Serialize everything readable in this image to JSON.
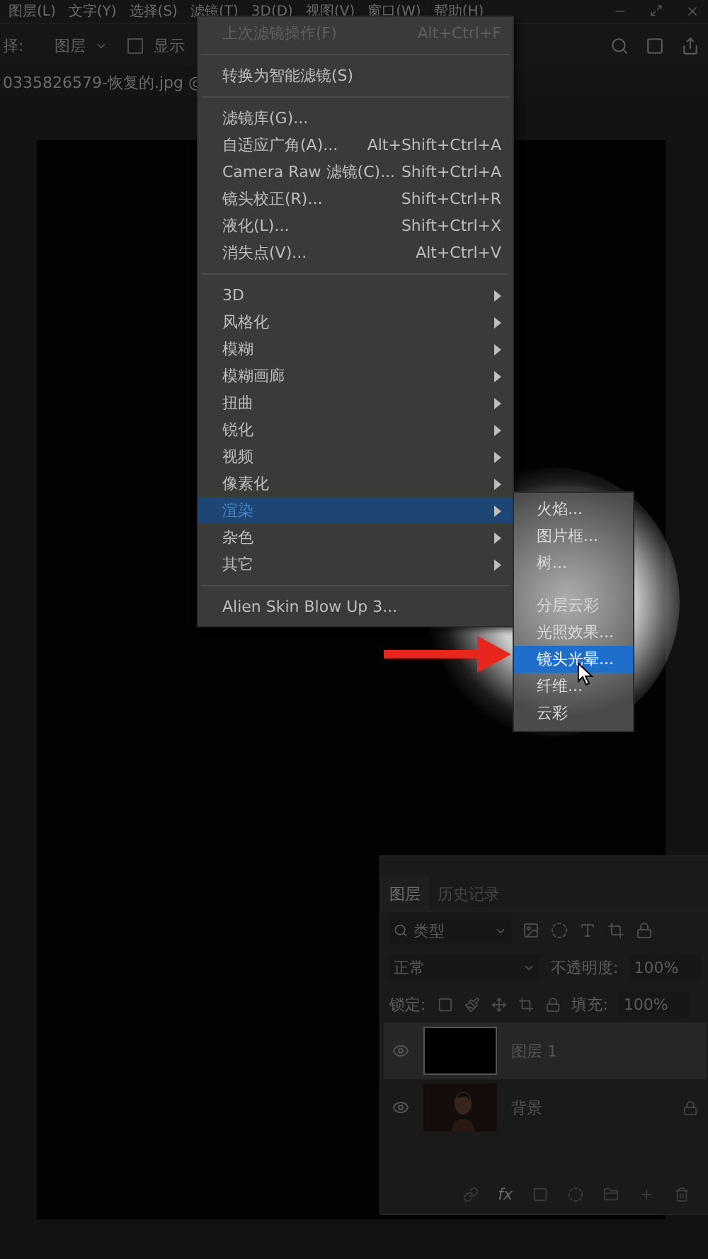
{
  "menubar": [
    {
      "label": "图层(L)"
    },
    {
      "label": "文字(Y)"
    },
    {
      "label": "选择(S)"
    },
    {
      "label": "滤镜(T)"
    },
    {
      "label": "3D(D)"
    },
    {
      "label": "视图(V)"
    },
    {
      "label": "窗口(W)"
    },
    {
      "label": "帮助(H)"
    }
  ],
  "options_bar": {
    "label": "择:",
    "layer_select": "图层",
    "show_checkbox": {
      "label": "显示",
      "checked": false
    }
  },
  "document_tab": "0335826579-恢复的.jpg @",
  "filter_menu": [
    {
      "kind": "item",
      "label": "上次滤镜操作(F)",
      "shortcut": "Alt+Ctrl+F",
      "disabled": true,
      "selected": false
    },
    {
      "kind": "separator"
    },
    {
      "kind": "item",
      "label": "转换为智能滤镜(S)",
      "disabled": false,
      "selected": false
    },
    {
      "kind": "separator"
    },
    {
      "kind": "item",
      "label": "滤镜库(G)...",
      "disabled": false,
      "selected": false
    },
    {
      "kind": "item",
      "label": "自适应广角(A)...",
      "shortcut": "Alt+Shift+Ctrl+A",
      "disabled": false,
      "selected": false
    },
    {
      "kind": "item",
      "label": "Camera Raw 滤镜(C)...",
      "shortcut": "Shift+Ctrl+A",
      "disabled": false,
      "selected": false
    },
    {
      "kind": "item",
      "label": "镜头校正(R)...",
      "shortcut": "Shift+Ctrl+R",
      "disabled": false,
      "selected": false
    },
    {
      "kind": "item",
      "label": "液化(L)...",
      "shortcut": "Shift+Ctrl+X",
      "disabled": false,
      "selected": false
    },
    {
      "kind": "item",
      "label": "消失点(V)...",
      "shortcut": "Alt+Ctrl+V",
      "disabled": false,
      "selected": false
    },
    {
      "kind": "separator"
    },
    {
      "kind": "submenu",
      "label": "3D",
      "disabled": false,
      "selected": false
    },
    {
      "kind": "submenu",
      "label": "风格化",
      "disabled": false,
      "selected": false
    },
    {
      "kind": "submenu",
      "label": "模糊",
      "disabled": false,
      "selected": false
    },
    {
      "kind": "submenu",
      "label": "模糊画廊",
      "disabled": false,
      "selected": false
    },
    {
      "kind": "submenu",
      "label": "扭曲",
      "disabled": false,
      "selected": false
    },
    {
      "kind": "submenu",
      "label": "锐化",
      "disabled": false,
      "selected": false
    },
    {
      "kind": "submenu",
      "label": "视频",
      "disabled": false,
      "selected": false
    },
    {
      "kind": "submenu",
      "label": "像素化",
      "disabled": false,
      "selected": false
    },
    {
      "kind": "submenu",
      "label": "渲染",
      "disabled": false,
      "selected": true
    },
    {
      "kind": "submenu",
      "label": "杂色",
      "disabled": false,
      "selected": false
    },
    {
      "kind": "submenu",
      "label": "其它",
      "disabled": false,
      "selected": false
    },
    {
      "kind": "separator"
    },
    {
      "kind": "item",
      "label": "Alien Skin Blow Up 3...",
      "disabled": false,
      "selected": false
    }
  ],
  "render_submenu": [
    {
      "kind": "item",
      "label": "火焰...",
      "selected": false
    },
    {
      "kind": "item",
      "label": "图片框...",
      "selected": false
    },
    {
      "kind": "item",
      "label": "树...",
      "selected": false
    },
    {
      "kind": "separator"
    },
    {
      "kind": "item",
      "label": "分层云彩",
      "selected": false
    },
    {
      "kind": "item",
      "label": "光照效果...",
      "selected": false
    },
    {
      "kind": "item",
      "label": "镜头光晕...",
      "selected": true
    },
    {
      "kind": "item",
      "label": "纤维...",
      "selected": false
    },
    {
      "kind": "item",
      "label": "云彩",
      "selected": false
    }
  ],
  "layers_panel": {
    "tabs": [
      {
        "label": "图层",
        "selected": true
      },
      {
        "label": "历史记录",
        "selected": false
      }
    ],
    "filter": "类型",
    "blend_mode": "正常",
    "opacity_label": "不透明度:",
    "opacity": "100%",
    "lock_label": "锁定:",
    "fill_label": "填充:",
    "fill": "100%",
    "layers": [
      {
        "kind": "solid",
        "name": "图层 1",
        "selected": true,
        "locked": false,
        "visible": true
      },
      {
        "kind": "picture",
        "name": "背景",
        "selected": false,
        "locked": true,
        "visible": true
      }
    ],
    "effects_button": "fx"
  }
}
